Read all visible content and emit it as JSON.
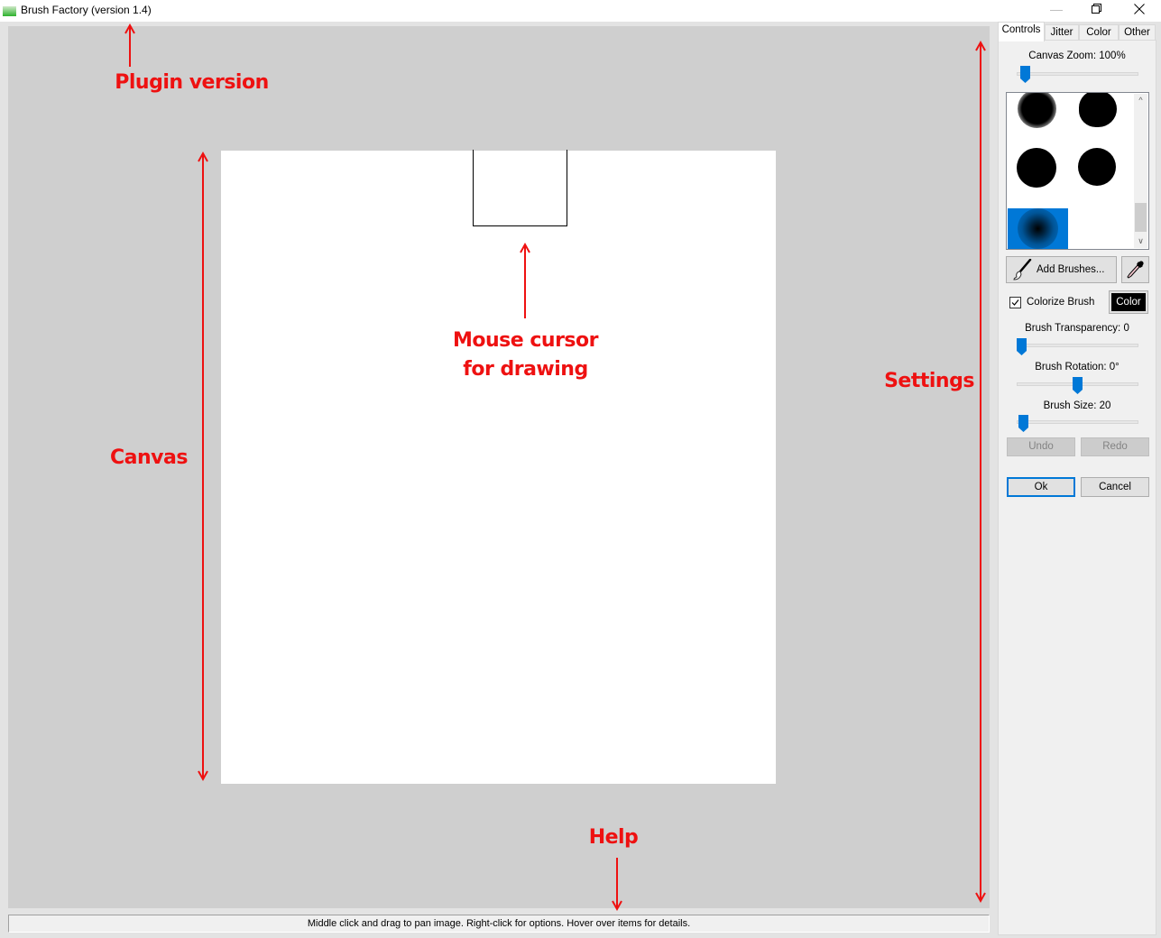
{
  "window": {
    "title": "Brush Factory (version 1.4)",
    "app_icon": "brush-factory-logo-icon",
    "controls": {
      "minimize": "—",
      "maximize": "restore-icon",
      "close": "✕"
    }
  },
  "status_bar": {
    "text": "Middle click and drag to pan image. Right-click for options. Hover over items for details."
  },
  "tabs": [
    {
      "label": "Controls",
      "active": true
    },
    {
      "label": "Jitter",
      "active": false
    },
    {
      "label": "Color",
      "active": false
    },
    {
      "label": "Other",
      "active": false
    }
  ],
  "controls": {
    "canvas_zoom": {
      "label": "Canvas Zoom: 100%",
      "value_percent": 100,
      "slider_fraction": 0.03
    },
    "brushes": [
      {
        "name": "soft-edge-round",
        "selected": false
      },
      {
        "name": "rough-edge-round",
        "selected": false
      },
      {
        "name": "hard-round",
        "selected": false
      },
      {
        "name": "slight-soft-round",
        "selected": false
      },
      {
        "name": "radial-gradient",
        "selected": true
      }
    ],
    "add_brushes_label": "Add Brushes...",
    "colorize_brush": {
      "label": "Colorize Brush",
      "checked": true
    },
    "color_button_label": "Color",
    "brush_color": "#000000",
    "brush_transparency": {
      "label": "Brush Transparency: 0",
      "value": 0,
      "slider_fraction": 0.0
    },
    "brush_rotation": {
      "label": "Brush Rotation: 0°",
      "value": 0,
      "slider_fraction": 0.5
    },
    "brush_size": {
      "label": "Brush Size: 20",
      "value": 20,
      "slider_fraction": 0.02
    },
    "undo_label": "Undo",
    "redo_label": "Redo",
    "ok_label": "Ok",
    "cancel_label": "Cancel"
  },
  "annotations": {
    "plugin_version": "Plugin version",
    "mouse_cursor_line1": "Mouse cursor",
    "mouse_cursor_line2": "for drawing",
    "canvas": "Canvas",
    "settings": "Settings",
    "help": "Help"
  },
  "colors": {
    "accent": "#0078d7",
    "annotation": "#ee1111",
    "canvas_bg": "#cfcfcf",
    "panel_bg": "#f0f0f0"
  }
}
